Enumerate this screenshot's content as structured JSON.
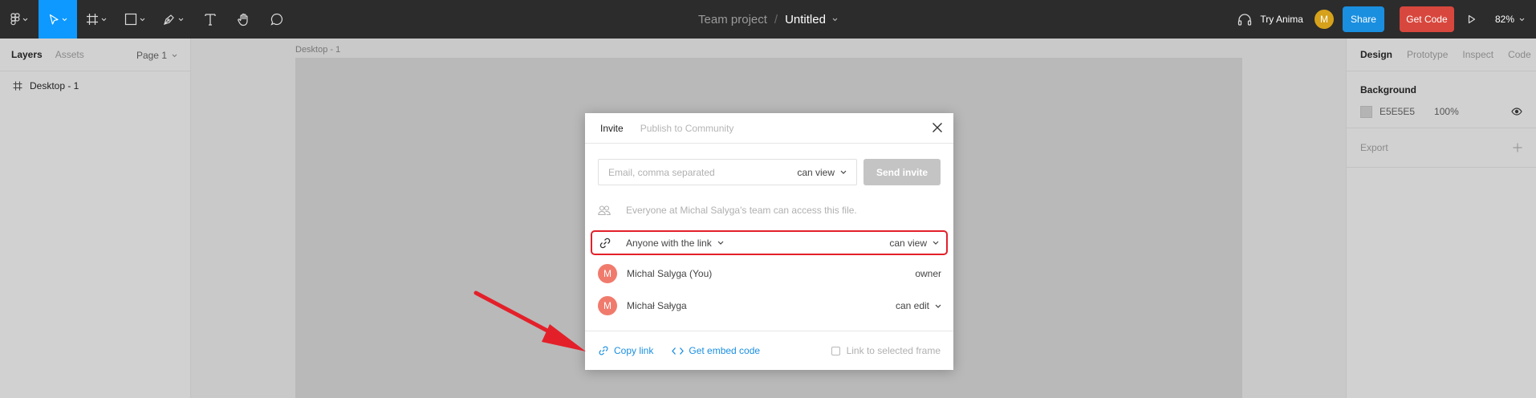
{
  "toolbar": {
    "project": "Team project",
    "separator": "/",
    "file_name": "Untitled",
    "try_anima": "Try Anima",
    "user_initial": "M",
    "share_label": "Share",
    "get_code_label": "Get Code",
    "zoom": "82%"
  },
  "left_panel": {
    "tabs": [
      "Layers",
      "Assets"
    ],
    "page": "Page 1",
    "layers": [
      "Desktop - 1"
    ]
  },
  "canvas": {
    "frame_label": "Desktop - 1"
  },
  "right_panel": {
    "tabs": [
      "Design",
      "Prototype",
      "Inspect",
      "Code"
    ],
    "background_heading": "Background",
    "background_hex": "E5E5E5",
    "background_opacity": "100%",
    "export_label": "Export"
  },
  "modal": {
    "tabs": [
      "Invite",
      "Publish to Community"
    ],
    "email_placeholder": "Email, comma separated",
    "invite_permission": "can view",
    "send_invite": "Send invite",
    "team_access_text": "Everyone at Michal Salyga's team can access this file.",
    "link_access": "Anyone with the link",
    "link_permission": "can view",
    "people": [
      {
        "initial": "M",
        "name": "Michal Salyga (You)",
        "role": "owner"
      },
      {
        "initial": "M",
        "name": "Michał Sałyga",
        "role": "can edit"
      }
    ],
    "copy_link": "Copy link",
    "embed_code": "Get embed code",
    "link_to_frame": "Link to selected frame"
  },
  "colors": {
    "highlight": "#e3202a",
    "accent_blue": "#1a8fe0",
    "avatar": "#f07b6d"
  }
}
